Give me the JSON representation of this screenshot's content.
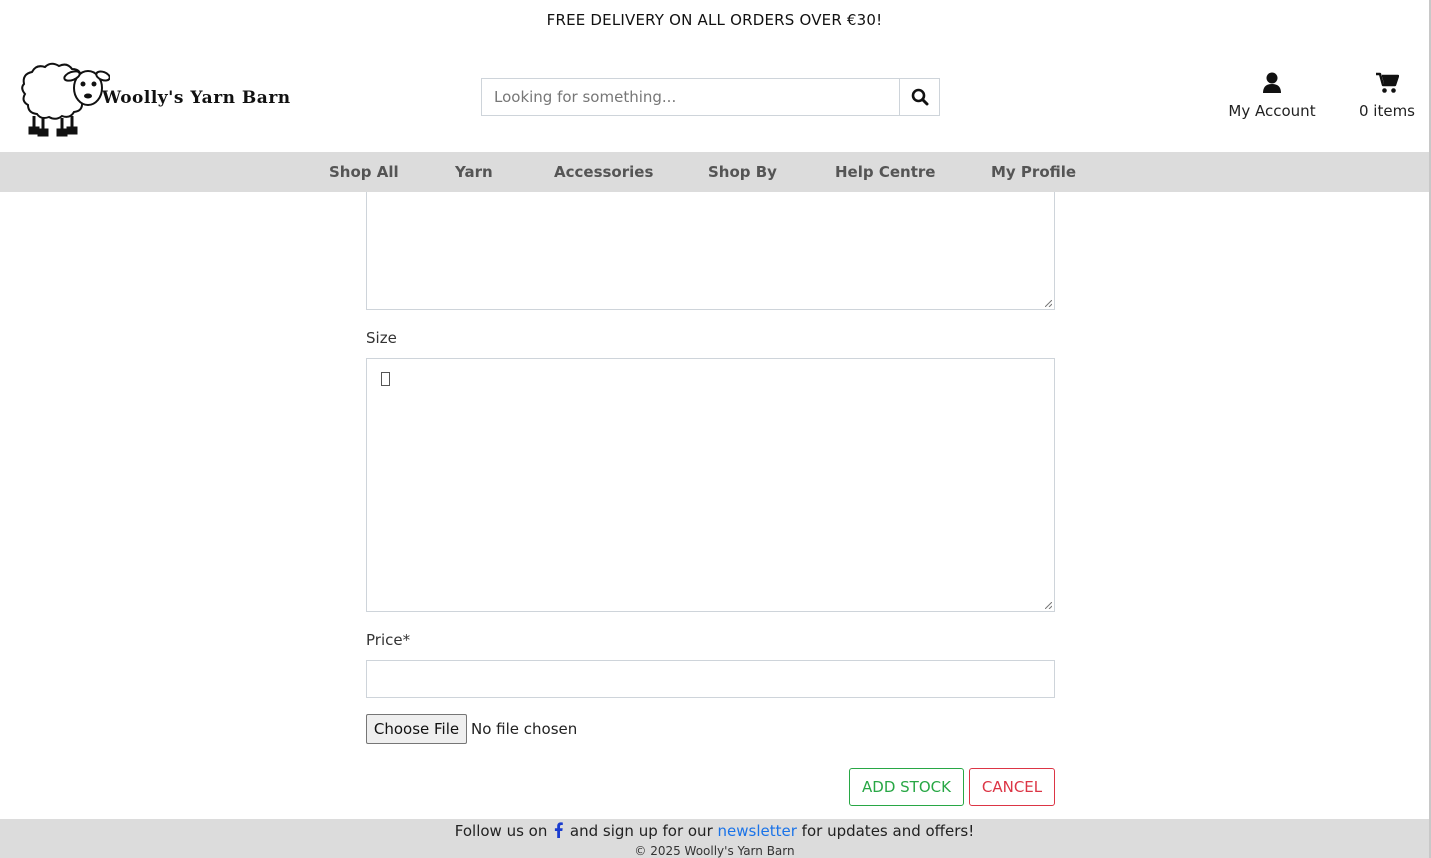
{
  "promo": {
    "text": "FREE DELIVERY ON ALL ORDERS OVER €30!"
  },
  "brand": {
    "name": "Woolly's Yarn Barn"
  },
  "search": {
    "placeholder": "Looking for something..."
  },
  "header": {
    "account_label": "My Account",
    "cart_label": "0 items"
  },
  "nav": {
    "items": [
      {
        "label": "Shop All"
      },
      {
        "label": "Yarn"
      },
      {
        "label": "Accessories"
      },
      {
        "label": "Shop By"
      },
      {
        "label": "Help Centre"
      },
      {
        "label": "My Profile"
      }
    ]
  },
  "form": {
    "size_label": "Size",
    "price_label": "Price*",
    "file_button": "Choose File",
    "file_status": "No file chosen",
    "add_stock": "ADD STOCK",
    "cancel": "CANCEL"
  },
  "footer": {
    "follow_prefix": "Follow us on",
    "follow_middle": "and sign up for our",
    "newsletter_link": "newsletter",
    "follow_suffix": "for updates and offers!",
    "copyright": "© 2025 Woolly's Yarn Barn"
  },
  "colors": {
    "nav_bg": "#dcdcdc",
    "add_button": "#28a745",
    "cancel_button": "#dc3545",
    "link": "#1a73e8",
    "facebook_icon": "#1a3ccf"
  },
  "icons": {
    "search": "search-icon",
    "account": "user-icon",
    "cart": "cart-icon",
    "facebook": "facebook-icon",
    "logo": "sheep-logo"
  }
}
